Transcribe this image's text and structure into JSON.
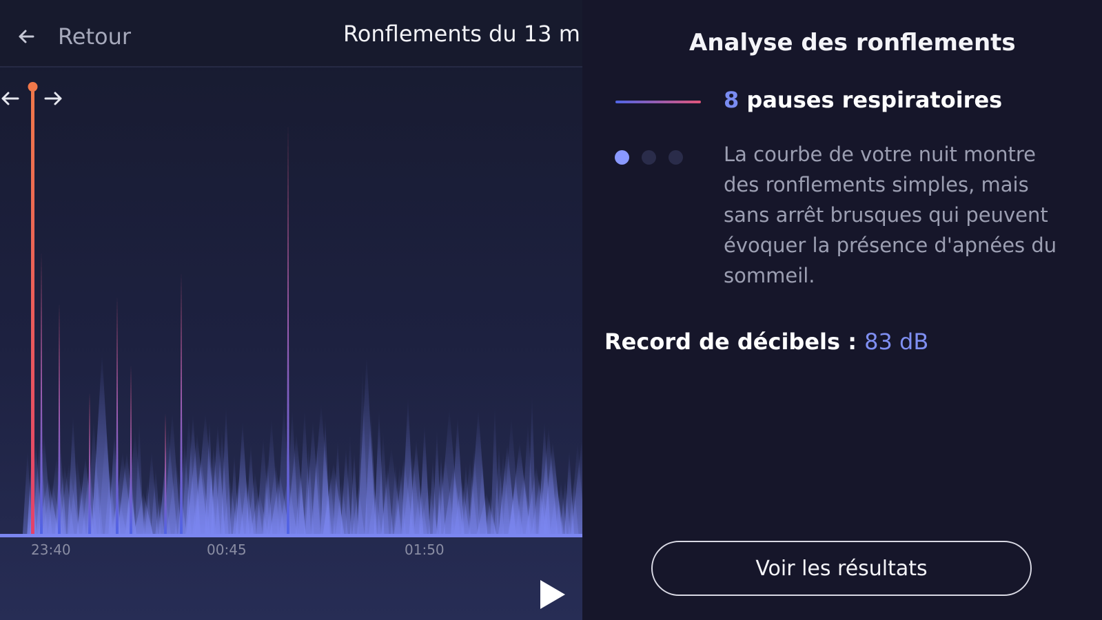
{
  "header": {
    "back_label": "Retour",
    "title": "Ronflements du 13 m"
  },
  "chart_data": {
    "type": "area",
    "x_tick_labels": [
      "23:40",
      "00:45",
      "01:50"
    ],
    "pause_markers_count": 8,
    "colors": {
      "pause_line_top": "#e2557a",
      "pause_line_bottom": "#5065e6",
      "cursor": "#ef6a4a",
      "area": "#7b86f0"
    }
  },
  "player": {
    "play_icon": "play-icon"
  },
  "analysis": {
    "title": "Analyse des ronflements",
    "pauses_count": "8",
    "pauses_label": "pauses respiratoires",
    "description": "La courbe de votre nuit montre des ronflements simples, mais sans arrêt brusques qui peuvent évoquer la présence d'apnées du sommeil.",
    "record_label": "Record de décibels :",
    "record_value": "83 dB",
    "pager_dots": 3,
    "pager_active": 0,
    "button_label": "Voir les résultats"
  }
}
